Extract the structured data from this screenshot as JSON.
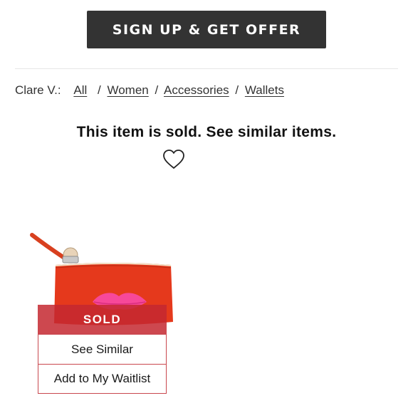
{
  "offer": {
    "button_label": "SIGN UP & GET OFFER"
  },
  "breadcrumb": {
    "brand": "Clare V.:",
    "items": [
      "All",
      "Women",
      "Accessories",
      "Wallets"
    ],
    "separator": "/"
  },
  "product": {
    "notice": "This item is sold. See similar items.",
    "status_label": "SOLD",
    "see_similar_label": "See Similar",
    "waitlist_label": "Add to My Waitlist"
  },
  "icons": {
    "favorite": "heart-outline-icon"
  },
  "colors": {
    "cta_bg": "#333333",
    "sold_red": "#c42830",
    "pouch_red": "#e5391c",
    "lips_pink": "#f7489a"
  }
}
